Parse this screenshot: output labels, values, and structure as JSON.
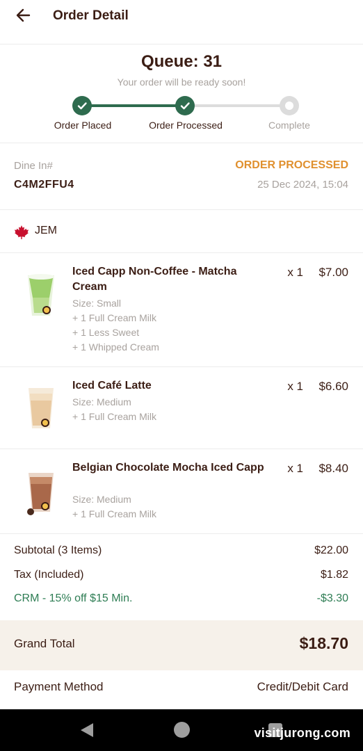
{
  "header": {
    "title": "Order Detail"
  },
  "queue": {
    "title": "Queue: 31",
    "subtitle": "Your order will be ready soon!",
    "steps": [
      {
        "label": "Order Placed",
        "state": "done"
      },
      {
        "label": "Order Processed",
        "state": "done"
      },
      {
        "label": "Complete",
        "state": "pending"
      }
    ]
  },
  "order": {
    "dine_label": "Dine In#",
    "code": "C4M2FFU4",
    "status": "ORDER PROCESSED",
    "datetime": "25 Dec 2024, 15:04"
  },
  "store": {
    "name": "JEM",
    "icon": "maple-leaf-icon"
  },
  "items": [
    {
      "name": "Iced Capp Non-Coffee - Matcha Cream",
      "qty": "x 1",
      "price": "$7.00",
      "options": [
        "Size: Small",
        "+ 1 Full Cream Milk",
        "+ 1 Less Sweet",
        "+ 1 Whipped Cream"
      ]
    },
    {
      "name": "Iced Café Latte",
      "qty": "x 1",
      "price": "$6.60",
      "options": [
        "Size: Medium",
        "+ 1 Full Cream Milk"
      ]
    },
    {
      "name": "Belgian Chocolate Mocha Iced Capp",
      "qty": "x 1",
      "price": "$8.40",
      "options": [
        "Size: Medium",
        "+ 1 Full Cream Milk"
      ]
    }
  ],
  "summary": {
    "subtotal_label": "Subtotal (3 Items)",
    "subtotal_value": "$22.00",
    "tax_label": "Tax (Included)",
    "tax_value": "$1.82",
    "discount_label": "CRM - 15% off $15 Min.",
    "discount_value": "-$3.30"
  },
  "grand_total": {
    "label": "Grand Total",
    "value": "$18.70"
  },
  "payment": {
    "label": "Payment Method",
    "value": "Credit/Debit Card"
  },
  "watermark": "visitjurong.com",
  "colors": {
    "brand_dark": "#3b1d14",
    "progress_green": "#2e6b4e",
    "status_orange": "#e0902e",
    "discount_green": "#2e7d54",
    "muted": "#a8a29e"
  }
}
